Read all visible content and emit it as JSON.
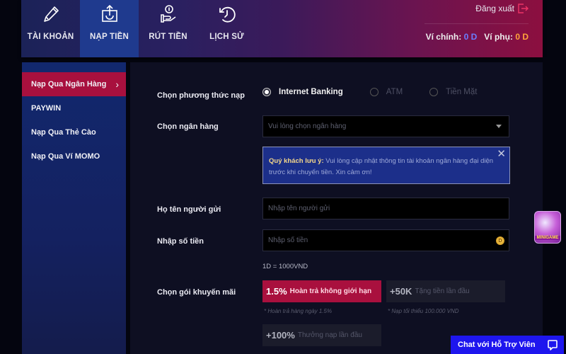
{
  "topbar": {
    "nav": [
      {
        "label": "TÀI KHOẢN",
        "icon": "pencil-icon"
      },
      {
        "label": "NẠP TIỀN",
        "icon": "deposit-icon",
        "active": true
      },
      {
        "label": "RÚT TIỀN",
        "icon": "withdraw-hand-coin-icon"
      },
      {
        "label": "LỊCH SỬ",
        "icon": "history-clock-icon"
      }
    ],
    "logout_label": "Đăng xuất",
    "wallet": {
      "main_label": "Ví chính:",
      "main_value": "0 D",
      "sub_label": "Ví phụ:",
      "sub_value": "0 D"
    },
    "colors": {
      "main_wallet": "#6b7dff",
      "sub_wallet": "#ffa53b"
    }
  },
  "sidebar": {
    "items": [
      {
        "label": "Nạp Qua Ngân Hàng",
        "active": true
      },
      {
        "label": "PAYWIN"
      },
      {
        "label": "Nạp Qua Thẻ Cào"
      },
      {
        "label": "Nạp Qua Ví MOMO"
      }
    ],
    "chevron": "›"
  },
  "form": {
    "method_label": "Chọn phương thức nạp",
    "methods": [
      {
        "label": "Internet Banking",
        "checked": true
      },
      {
        "label": "ATM",
        "checked": false
      },
      {
        "label": "Tiền Mặt",
        "checked": false
      }
    ],
    "bank_label": "Chọn ngân hàng",
    "bank_placeholder": "Vui lòng chọn ngân hàng",
    "notice_title": "Quý khách lưu ý:",
    "notice_text": " Vui lòng cập nhật thông tin tài khoản ngân hàng đại diện trước khi chuyển tiền. Xin cảm ơn!",
    "notice_close": "✕",
    "sender_label": "Họ tên người gửi",
    "sender_placeholder": "Nhập tên người gửi",
    "amount_label": "Nhập số tiền",
    "amount_placeholder": "Nhập số tiền",
    "coin_symbol": "D",
    "rate_text": "1D = 1000VND",
    "promo_label": "Chọn gói khuyến mãi",
    "promos": [
      {
        "big": "1.5%",
        "desc": "Hoàn trả không giới hạn",
        "note": "* Hoàn trả hàng ngày 1.5%",
        "active": true
      },
      {
        "big": "+50K",
        "desc": "Tặng tiền lần đầu",
        "note": "* Nạp tối thiểu 100.000 VND",
        "active": false
      },
      {
        "big": "+100%",
        "desc": "Thưởng nạp lần đầu",
        "note": "",
        "active": false
      }
    ]
  },
  "widgets": {
    "minigame_label": "MINIGAME",
    "chat_label": "Chat với Hỗ Trợ Viên"
  }
}
